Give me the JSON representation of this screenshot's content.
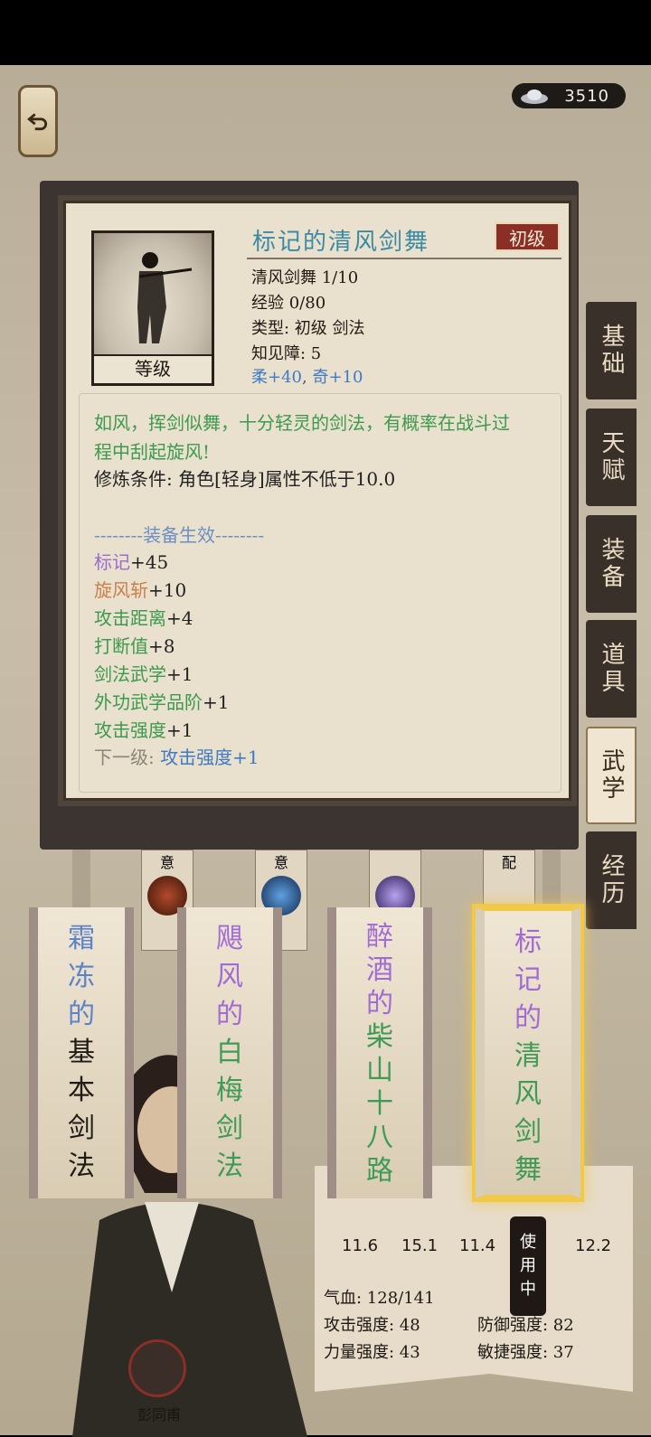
{
  "currency": {
    "amount": "3510",
    "icon": "silver-ingot-icon"
  },
  "side_tabs": [
    {
      "label": "基础"
    },
    {
      "label": "天赋"
    },
    {
      "label": "装备"
    },
    {
      "label": "道具"
    },
    {
      "label": "武学",
      "active": true
    },
    {
      "label": "经历"
    }
  ],
  "popup": {
    "title": "标记的清风剑舞",
    "rank": "初级",
    "portrait_label": "等级",
    "meta": [
      "清风剑舞 1/10",
      "经验 0/80",
      "类型: 初级 剑法",
      "知见障: 5"
    ],
    "bonus": {
      "a": "柔+40",
      "sep": ",",
      "b": "奇+10"
    },
    "desc_line_1": "如风，挥剑似舞，十分轻灵的剑法，有概率在战斗过",
    "desc_line_2": "程中刮起旋风!",
    "requirement": "修炼条件: 角色[轻身]属性不低于10.0",
    "equip_header": "--------装备生效--------",
    "effects": [
      {
        "name": "标记",
        "value": "+45",
        "color": "purple"
      },
      {
        "name": "旋风斩",
        "value": "+10",
        "color": "orange"
      },
      {
        "name": "攻击距离",
        "value": "+4",
        "color": "green"
      },
      {
        "name": "打断值",
        "value": "+8",
        "color": "green"
      },
      {
        "name": "剑法武学",
        "value": "+1",
        "color": "green"
      },
      {
        "name": "外功武学品阶",
        "value": "+1",
        "color": "green"
      },
      {
        "name": "攻击强度",
        "value": "+1",
        "color": "green"
      }
    ],
    "next_level_label": "下一级: ",
    "next_level_value": "攻击强度+1"
  },
  "skill_slots": [
    {
      "label": "意"
    },
    {
      "label": "意"
    },
    {
      "label": ""
    },
    {
      "label": "配"
    }
  ],
  "cards": [
    {
      "chars": [
        "霜",
        "冻",
        "的",
        "基",
        "本",
        "剑",
        "法"
      ],
      "colors": [
        "#5c82c9",
        "#5c82c9",
        "#5c82c9",
        "#1f1a14",
        "#1f1a14",
        "#1f1a14",
        "#1f1a14"
      ]
    },
    {
      "chars": [
        "飓",
        "风",
        "的",
        "白",
        "梅",
        "剑",
        "法"
      ],
      "colors": [
        "#a06bd4",
        "#a06bd4",
        "#a06bd4",
        "#3f9a55",
        "#3f9a55",
        "#3f9a55",
        "#3f9a55"
      ]
    },
    {
      "chars": [
        "醉",
        "酒",
        "的",
        "柴",
        "山",
        "十",
        "八",
        "路"
      ],
      "colors": [
        "#a06bd4",
        "#a06bd4",
        "#a06bd4",
        "#3f9a55",
        "#3f9a55",
        "#3f9a55",
        "#3f9a55",
        "#3f9a55"
      ]
    },
    {
      "chars": [
        "标",
        "记",
        "的",
        "清",
        "风",
        "剑",
        "舞"
      ],
      "colors": [
        "#a06bd4",
        "#a06bd4",
        "#a06bd4",
        "#3f9a55",
        "#3f9a55",
        "#3f9a55",
        "#3f9a55"
      ],
      "selected": true
    }
  ],
  "stats": {
    "values": [
      "11.6",
      "15.1",
      "11.4",
      "12.2"
    ],
    "hp": "气血: 128/141",
    "atk": "攻击强度: 48",
    "def": "防御强度: 82",
    "str": "力量强度: 43",
    "agi": "敏捷强度: 37",
    "using": [
      "使",
      "用",
      "中"
    ]
  },
  "character": {
    "name": "彭同甫"
  }
}
